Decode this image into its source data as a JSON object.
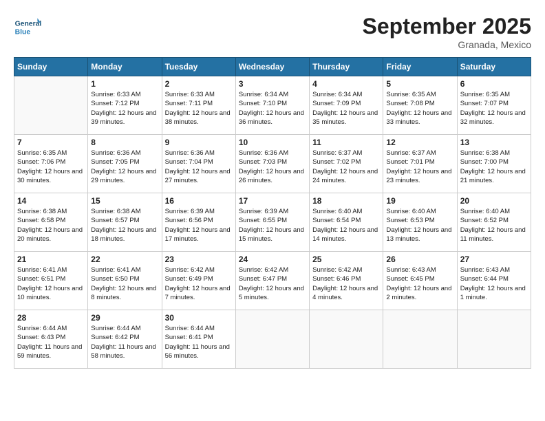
{
  "header": {
    "logo_general": "General",
    "logo_blue": "Blue",
    "month": "September 2025",
    "location": "Granada, Mexico"
  },
  "days_of_week": [
    "Sunday",
    "Monday",
    "Tuesday",
    "Wednesday",
    "Thursday",
    "Friday",
    "Saturday"
  ],
  "weeks": [
    [
      {
        "day": "",
        "empty": true
      },
      {
        "day": "1",
        "sunrise": "Sunrise: 6:33 AM",
        "sunset": "Sunset: 7:12 PM",
        "daylight": "Daylight: 12 hours and 39 minutes."
      },
      {
        "day": "2",
        "sunrise": "Sunrise: 6:33 AM",
        "sunset": "Sunset: 7:11 PM",
        "daylight": "Daylight: 12 hours and 38 minutes."
      },
      {
        "day": "3",
        "sunrise": "Sunrise: 6:34 AM",
        "sunset": "Sunset: 7:10 PM",
        "daylight": "Daylight: 12 hours and 36 minutes."
      },
      {
        "day": "4",
        "sunrise": "Sunrise: 6:34 AM",
        "sunset": "Sunset: 7:09 PM",
        "daylight": "Daylight: 12 hours and 35 minutes."
      },
      {
        "day": "5",
        "sunrise": "Sunrise: 6:35 AM",
        "sunset": "Sunset: 7:08 PM",
        "daylight": "Daylight: 12 hours and 33 minutes."
      },
      {
        "day": "6",
        "sunrise": "Sunrise: 6:35 AM",
        "sunset": "Sunset: 7:07 PM",
        "daylight": "Daylight: 12 hours and 32 minutes."
      }
    ],
    [
      {
        "day": "7",
        "sunrise": "Sunrise: 6:35 AM",
        "sunset": "Sunset: 7:06 PM",
        "daylight": "Daylight: 12 hours and 30 minutes."
      },
      {
        "day": "8",
        "sunrise": "Sunrise: 6:36 AM",
        "sunset": "Sunset: 7:05 PM",
        "daylight": "Daylight: 12 hours and 29 minutes."
      },
      {
        "day": "9",
        "sunrise": "Sunrise: 6:36 AM",
        "sunset": "Sunset: 7:04 PM",
        "daylight": "Daylight: 12 hours and 27 minutes."
      },
      {
        "day": "10",
        "sunrise": "Sunrise: 6:36 AM",
        "sunset": "Sunset: 7:03 PM",
        "daylight": "Daylight: 12 hours and 26 minutes."
      },
      {
        "day": "11",
        "sunrise": "Sunrise: 6:37 AM",
        "sunset": "Sunset: 7:02 PM",
        "daylight": "Daylight: 12 hours and 24 minutes."
      },
      {
        "day": "12",
        "sunrise": "Sunrise: 6:37 AM",
        "sunset": "Sunset: 7:01 PM",
        "daylight": "Daylight: 12 hours and 23 minutes."
      },
      {
        "day": "13",
        "sunrise": "Sunrise: 6:38 AM",
        "sunset": "Sunset: 7:00 PM",
        "daylight": "Daylight: 12 hours and 21 minutes."
      }
    ],
    [
      {
        "day": "14",
        "sunrise": "Sunrise: 6:38 AM",
        "sunset": "Sunset: 6:58 PM",
        "daylight": "Daylight: 12 hours and 20 minutes."
      },
      {
        "day": "15",
        "sunrise": "Sunrise: 6:38 AM",
        "sunset": "Sunset: 6:57 PM",
        "daylight": "Daylight: 12 hours and 18 minutes."
      },
      {
        "day": "16",
        "sunrise": "Sunrise: 6:39 AM",
        "sunset": "Sunset: 6:56 PM",
        "daylight": "Daylight: 12 hours and 17 minutes."
      },
      {
        "day": "17",
        "sunrise": "Sunrise: 6:39 AM",
        "sunset": "Sunset: 6:55 PM",
        "daylight": "Daylight: 12 hours and 15 minutes."
      },
      {
        "day": "18",
        "sunrise": "Sunrise: 6:40 AM",
        "sunset": "Sunset: 6:54 PM",
        "daylight": "Daylight: 12 hours and 14 minutes."
      },
      {
        "day": "19",
        "sunrise": "Sunrise: 6:40 AM",
        "sunset": "Sunset: 6:53 PM",
        "daylight": "Daylight: 12 hours and 13 minutes."
      },
      {
        "day": "20",
        "sunrise": "Sunrise: 6:40 AM",
        "sunset": "Sunset: 6:52 PM",
        "daylight": "Daylight: 12 hours and 11 minutes."
      }
    ],
    [
      {
        "day": "21",
        "sunrise": "Sunrise: 6:41 AM",
        "sunset": "Sunset: 6:51 PM",
        "daylight": "Daylight: 12 hours and 10 minutes."
      },
      {
        "day": "22",
        "sunrise": "Sunrise: 6:41 AM",
        "sunset": "Sunset: 6:50 PM",
        "daylight": "Daylight: 12 hours and 8 minutes."
      },
      {
        "day": "23",
        "sunrise": "Sunrise: 6:42 AM",
        "sunset": "Sunset: 6:49 PM",
        "daylight": "Daylight: 12 hours and 7 minutes."
      },
      {
        "day": "24",
        "sunrise": "Sunrise: 6:42 AM",
        "sunset": "Sunset: 6:47 PM",
        "daylight": "Daylight: 12 hours and 5 minutes."
      },
      {
        "day": "25",
        "sunrise": "Sunrise: 6:42 AM",
        "sunset": "Sunset: 6:46 PM",
        "daylight": "Daylight: 12 hours and 4 minutes."
      },
      {
        "day": "26",
        "sunrise": "Sunrise: 6:43 AM",
        "sunset": "Sunset: 6:45 PM",
        "daylight": "Daylight: 12 hours and 2 minutes."
      },
      {
        "day": "27",
        "sunrise": "Sunrise: 6:43 AM",
        "sunset": "Sunset: 6:44 PM",
        "daylight": "Daylight: 12 hours and 1 minute."
      }
    ],
    [
      {
        "day": "28",
        "sunrise": "Sunrise: 6:44 AM",
        "sunset": "Sunset: 6:43 PM",
        "daylight": "Daylight: 11 hours and 59 minutes."
      },
      {
        "day": "29",
        "sunrise": "Sunrise: 6:44 AM",
        "sunset": "Sunset: 6:42 PM",
        "daylight": "Daylight: 11 hours and 58 minutes."
      },
      {
        "day": "30",
        "sunrise": "Sunrise: 6:44 AM",
        "sunset": "Sunset: 6:41 PM",
        "daylight": "Daylight: 11 hours and 56 minutes."
      },
      {
        "day": "",
        "empty": true
      },
      {
        "day": "",
        "empty": true
      },
      {
        "day": "",
        "empty": true
      },
      {
        "day": "",
        "empty": true
      }
    ]
  ]
}
